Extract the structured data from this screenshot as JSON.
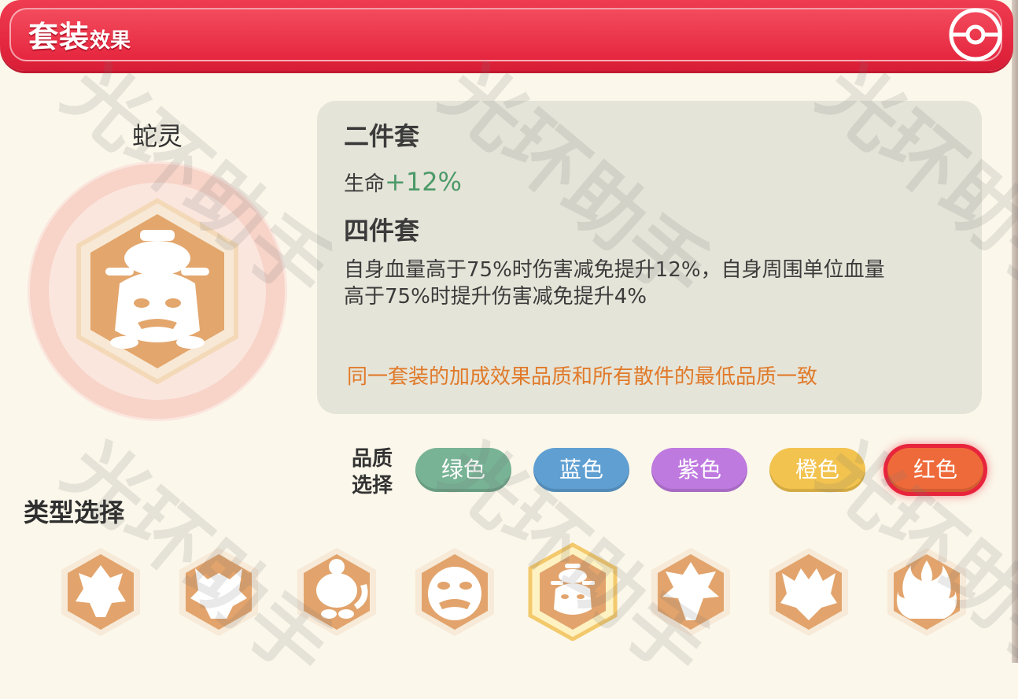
{
  "header": {
    "title_big": "套装",
    "title_small": "效果",
    "close_icon": "pokeball-close-icon"
  },
  "set": {
    "name": "蛇灵",
    "emblem_icon": "snake-spirit-emblem-icon",
    "two_piece_title": "二件套",
    "two_piece_stat_label": "生命",
    "two_piece_stat_value": "+12%",
    "four_piece_title": "四件套",
    "four_piece_desc_line1": "自身血量高于75%时伤害减免提升12%，自身周围单位血量",
    "four_piece_desc_line2": "高于75%时提升伤害减免提升4%",
    "note": "同一套装的加成效果品质和所有散件的最低品质一致"
  },
  "quality": {
    "label_line1": "品质",
    "label_line2": "选择",
    "selected": "红色",
    "options": [
      {
        "label": "绿色",
        "color": "#78b395"
      },
      {
        "label": "蓝色",
        "color": "#5f9fd2"
      },
      {
        "label": "紫色",
        "color": "#bf7ae0"
      },
      {
        "label": "橙色",
        "color": "#f2c34e"
      },
      {
        "label": "红色",
        "color": "#ef6a3a"
      }
    ]
  },
  "types": {
    "label": "类型选择",
    "selected_index": 4,
    "icons": [
      "dragon-emblem-icon",
      "wolf-emblem-icon",
      "flame-creature-emblem-icon",
      "beast-face-emblem-icon",
      "snake-spirit-emblem-icon",
      "bird-emblem-icon",
      "ghost-emblem-icon",
      "fire-spirit-emblem-icon"
    ]
  },
  "watermark": "光环助手",
  "colors": {
    "header_red": "#e4283f",
    "emblem_orange": "#e2a46c",
    "note_orange": "#e07a2a",
    "stat_green": "#4d9a6a"
  }
}
